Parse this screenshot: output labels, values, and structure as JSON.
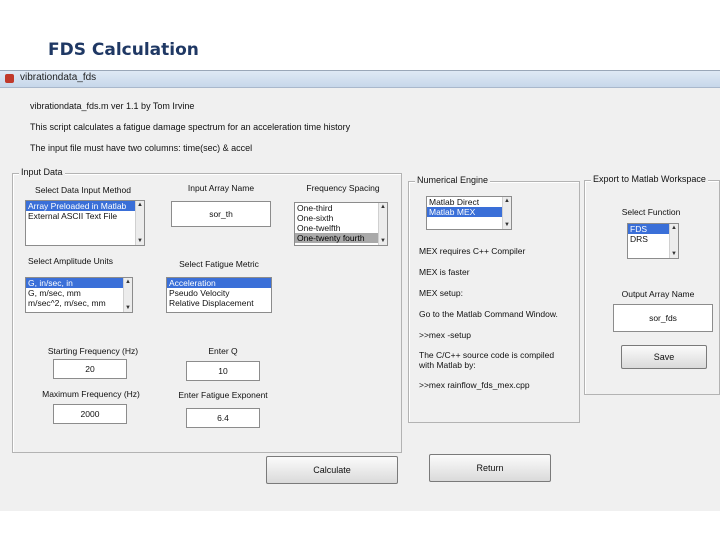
{
  "slide_title": "FDS Calculation",
  "window": {
    "title": "vibrationdata_fds"
  },
  "header": {
    "line1": "vibrationdata_fds.m  ver 1.1  by Tom Irvine",
    "line2": "This script calculates a fatigue damage spectrum for an acceleration time history",
    "line3": "The input file must have two columns:  time(sec) & accel"
  },
  "input_data": {
    "title": "Input Data",
    "input_method": {
      "label": "Select Data Input Method",
      "options": [
        "Array Preloaded in Matlab",
        "External ASCII Text File"
      ],
      "selected_index": 0
    },
    "array_name": {
      "label": "Input Array Name",
      "value": "sor_th"
    },
    "freq_spacing": {
      "label": "Frequency Spacing",
      "options": [
        "One-third",
        "One-sixth",
        "One-twelfth",
        "One-twenty fourth"
      ],
      "selected_index": 3
    },
    "amplitude_units": {
      "label": "Select Amplitude Units",
      "options": [
        "G, in/sec, in",
        "G, m/sec, mm",
        "m/sec^2, m/sec, mm"
      ],
      "selected_index": 0
    },
    "fatigue_metric": {
      "label": "Select Fatigue Metric",
      "options": [
        "Acceleration",
        "Pseudo Velocity",
        "Relative Displacement"
      ],
      "selected_index": 0
    },
    "start_freq": {
      "label": "Starting Frequency (Hz)",
      "value": "20"
    },
    "q": {
      "label": "Enter Q",
      "value": "10"
    },
    "max_freq": {
      "label": "Maximum Frequency (Hz)",
      "value": "2000"
    },
    "fatigue_exponent": {
      "label": "Enter Fatigue Exponent",
      "value": "6.4"
    }
  },
  "numerical_engine": {
    "title": "Numerical Engine",
    "options": [
      "Matlab Direct",
      "Matlab MEX"
    ],
    "selected_index": 1,
    "notes": [
      "MEX requires C++ Compiler",
      "MEX is faster",
      "MEX setup:",
      "Go to the Matlab Command Window.",
      ">>mex -setup",
      "The C/C++ source code is compiled",
      "with Matlab by:",
      ">>mex rainflow_fds_mex.cpp"
    ]
  },
  "export": {
    "title": "Export to Matlab Workspace",
    "function_label": "Select Function",
    "function_options": [
      "FDS",
      "DRS"
    ],
    "selected_index": 0,
    "output_label": "Output Array Name",
    "output_value": "sor_fds",
    "save_label": "Save"
  },
  "buttons": {
    "calculate": "Calculate",
    "return": "Return"
  },
  "colors": {
    "selection": "#3a6fd8",
    "title_text": "#1f3864",
    "window_bg": "#f0f0f0"
  },
  "icons": {
    "scroll_up": "▲",
    "scroll_down": "▼"
  }
}
